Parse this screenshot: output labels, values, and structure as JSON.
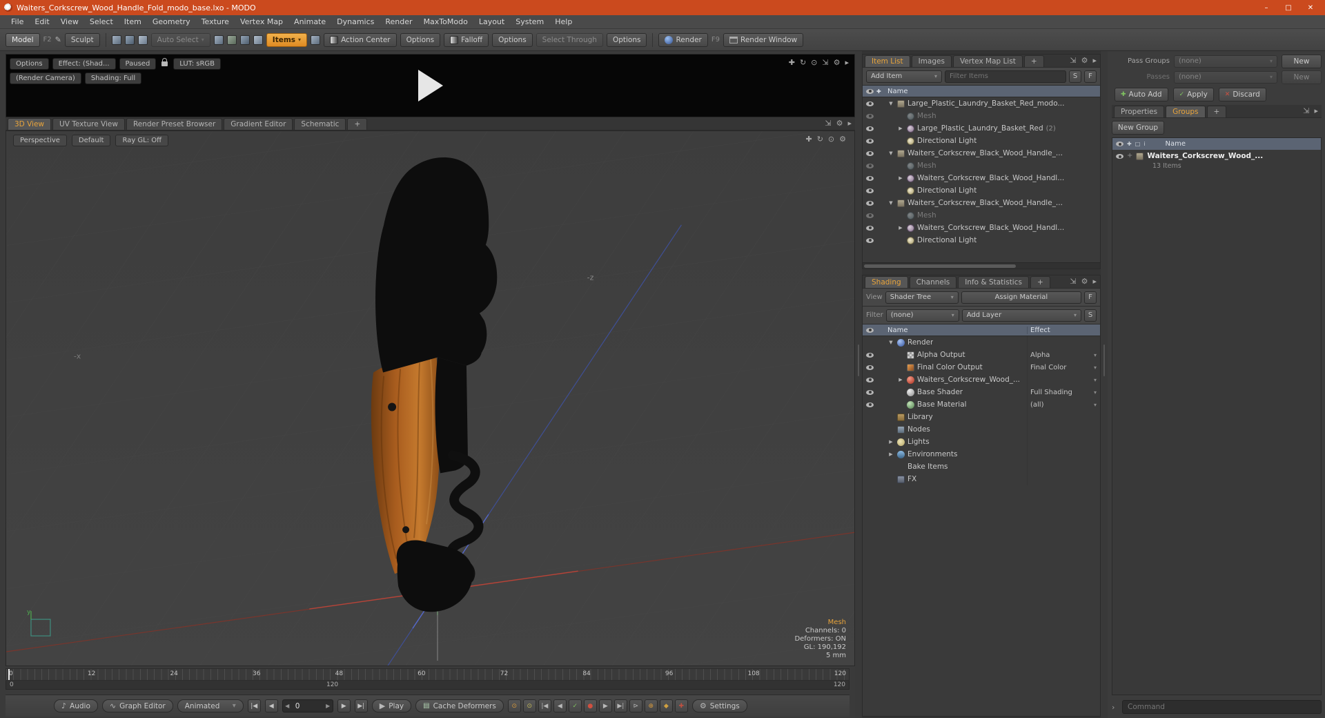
{
  "window": {
    "title": "Waiters_Corkscrew_Wood_Handle_Fold_modo_base.lxo - MODO",
    "minimize": "–",
    "maximize": "□",
    "close": "✕"
  },
  "menu": [
    "File",
    "Edit",
    "View",
    "Select",
    "Item",
    "Geometry",
    "Texture",
    "Vertex Map",
    "Animate",
    "Dynamics",
    "Render",
    "MaxToModo",
    "Layout",
    "System",
    "Help"
  ],
  "toolbar": {
    "model": "Model",
    "model_key": "F2",
    "sculpt": "Sculpt",
    "auto_select": "Auto Select",
    "items": "Items",
    "action_center": "Action Center",
    "options_a": "Options",
    "falloff": "Falloff",
    "options_b": "Options",
    "select_through": "Select Through",
    "options_c": "Options",
    "render": "Render",
    "render_key": "F9",
    "render_window": "Render Window"
  },
  "preview": {
    "options": "Options",
    "effect": "Effect: (Shad...",
    "paused": "Paused",
    "lut": "LUT: sRGB",
    "camera": "(Render Camera)",
    "shading": "Shading: Full"
  },
  "viewport": {
    "tabs": [
      {
        "label": "3D View",
        "active": true
      },
      {
        "label": "UV Texture View"
      },
      {
        "label": "Render Preset Browser"
      },
      {
        "label": "Gradient Editor"
      },
      {
        "label": "Schematic"
      },
      {
        "label": "+"
      }
    ],
    "perspective": "Perspective",
    "default_btn": "Default",
    "raygl": "Ray GL: Off",
    "axis_neg_z": "-z",
    "axis_neg_x": "-x",
    "axis_y": "y",
    "info": [
      "Mesh",
      "Channels: 0",
      "Deformers: ON",
      "GL: 190,192",
      "5 mm"
    ]
  },
  "timeline": {
    "ticks": [
      "0",
      "12",
      "24",
      "36",
      "48",
      "60",
      "72",
      "84",
      "96",
      "108",
      "120"
    ],
    "range_start": "0",
    "range_mid": "120",
    "range_end": "120"
  },
  "transport": {
    "audio": "Audio",
    "graph_editor": "Graph Editor",
    "mode": "Animated",
    "frame": "0",
    "play": "Play",
    "cache": "Cache Deformers",
    "settings": "Settings",
    "extra_icons": [
      {
        "glyph": "⊙",
        "name": "actor-icon",
        "color": "#d89a3c"
      },
      {
        "glyph": "⊙",
        "name": "pose-icon",
        "color": "#c6bb5a"
      },
      {
        "glyph": "|◀",
        "name": "previous-key-icon",
        "color": "#b8b8b8"
      },
      {
        "glyph": "◀",
        "name": "step-back-key-icon",
        "color": "#b8b8b8"
      },
      {
        "glyph": "✓",
        "name": "commit-icon",
        "color": "#7fc060"
      },
      {
        "glyph": "●",
        "name": "record-icon",
        "color": "#d05040"
      },
      {
        "glyph": "▶",
        "name": "step-forward-key-icon",
        "color": "#b8b8b8"
      },
      {
        "glyph": "▶|",
        "name": "next-key-icon",
        "color": "#b8b8b8"
      },
      {
        "glyph": "⊳",
        "name": "playback-options-icon",
        "color": "#b8b8b8"
      },
      {
        "glyph": "⊕",
        "name": "auto-key-icon",
        "color": "#d89a3c"
      },
      {
        "glyph": "◆",
        "name": "set-key-icon",
        "color": "#d0a040"
      },
      {
        "glyph": "✚",
        "name": "add-channel-key-icon",
        "color": "#c05040"
      }
    ]
  },
  "item_list": {
    "tabs": [
      {
        "label": "Item List",
        "active": true
      },
      {
        "label": "Images"
      },
      {
        "label": "Vertex Map List"
      },
      {
        "label": "+"
      }
    ],
    "add_item": "Add Item",
    "filter_placeholder": "Filter Items",
    "s_button": "S",
    "f_button": "F",
    "name_header": "Name",
    "rows": [
      {
        "indent": 1,
        "arrow": "open",
        "icon": "group",
        "label": "Large_Plastic_Laundry_Basket_Red_modo..."
      },
      {
        "indent": 2,
        "arrow": "none",
        "icon": "mesh",
        "label": "Mesh",
        "dim": true
      },
      {
        "indent": 2,
        "arrow": "closed",
        "icon": "meshinst",
        "label": "Large_Plastic_Laundry_Basket_Red",
        "count": "(2)"
      },
      {
        "indent": 2,
        "arrow": "none",
        "icon": "dirlight",
        "label": "Directional Light"
      },
      {
        "indent": 1,
        "arrow": "open",
        "icon": "group",
        "label": "Waiters_Corkscrew_Black_Wood_Handle_..."
      },
      {
        "indent": 2,
        "arrow": "none",
        "icon": "mesh",
        "label": "Mesh",
        "dim": true
      },
      {
        "indent": 2,
        "arrow": "closed",
        "icon": "meshinst",
        "label": "Waiters_Corkscrew_Black_Wood_Handl..."
      },
      {
        "indent": 2,
        "arrow": "none",
        "icon": "dirlight",
        "label": "Directional Light"
      },
      {
        "indent": 1,
        "arrow": "open",
        "icon": "group",
        "label": "Waiters_Corkscrew_Black_Wood_Handle_..."
      },
      {
        "indent": 2,
        "arrow": "none",
        "icon": "mesh",
        "label": "Mesh",
        "dim": true
      },
      {
        "indent": 2,
        "arrow": "closed",
        "icon": "meshinst",
        "label": "Waiters_Corkscrew_Black_Wood_Handl..."
      },
      {
        "indent": 2,
        "arrow": "none",
        "icon": "dirlight",
        "label": "Directional Light"
      }
    ]
  },
  "shading": {
    "tabs": [
      {
        "label": "Shading",
        "active": true
      },
      {
        "label": "Channels"
      },
      {
        "label": "Info & Statistics"
      },
      {
        "label": "+"
      }
    ],
    "view_label": "View",
    "view_value": "Shader Tree",
    "assign_material": "Assign Material",
    "f_button": "F",
    "filter_label": "Filter",
    "filter_value": "(none)",
    "add_layer": "Add Layer",
    "s_button": "S",
    "name_header": "Name",
    "effect_header": "Effect",
    "rows": [
      {
        "indent": 1,
        "arrow": "open",
        "icon": "render",
        "label": "Render",
        "effect": "",
        "eye": false
      },
      {
        "indent": 2,
        "arrow": "none",
        "icon": "alphaout",
        "label": "Alpha Output",
        "effect": "Alpha",
        "dd": true
      },
      {
        "indent": 2,
        "arrow": "none",
        "icon": "finalout",
        "label": "Final Color Output",
        "effect": "Final Color",
        "dd": true
      },
      {
        "indent": 2,
        "arrow": "closed",
        "icon": "matgroup",
        "label": "Waiters_Corkscrew_Wood_...",
        "effect": "",
        "dd": true
      },
      {
        "indent": 2,
        "arrow": "none",
        "icon": "shader",
        "label": "Base Shader",
        "effect": "Full Shading",
        "dd": true
      },
      {
        "indent": 2,
        "arrow": "none",
        "icon": "basemat",
        "label": "Base Material",
        "effect": "(all)",
        "dd": true
      },
      {
        "indent": 1,
        "arrow": "none",
        "icon": "library",
        "label": "Library",
        "effect": "",
        "eye": false
      },
      {
        "indent": 1,
        "arrow": "none",
        "icon": "nodes",
        "label": "Nodes",
        "effect": "",
        "eye": false
      },
      {
        "indent": 1,
        "arrow": "closed",
        "icon": "light",
        "label": "Lights",
        "effect": "",
        "eye": false
      },
      {
        "indent": 1,
        "arrow": "closed",
        "icon": "env",
        "label": "Environments",
        "effect": "",
        "eye": false
      },
      {
        "indent": 1,
        "arrow": "none",
        "icon": "bake",
        "label": "Bake Items",
        "effect": "",
        "eye": false
      },
      {
        "indent": 1,
        "arrow": "none",
        "icon": "fx",
        "label": "FX",
        "effect": "",
        "eye": false
      }
    ]
  },
  "groups_panel": {
    "pass_groups_label": "Pass Groups",
    "pass_groups_value": "(none)",
    "pass_groups_new": "New",
    "passes_label": "Passes",
    "passes_value": "(none)",
    "passes_new": "New",
    "auto_add": "Auto Add",
    "apply": "Apply",
    "discard": "Discard",
    "tabs": [
      {
        "label": "Properties"
      },
      {
        "label": "Groups",
        "active": true
      },
      {
        "label": "+"
      }
    ],
    "new_group": "New Group",
    "name_header": "Name",
    "row": {
      "label": "Waiters_Corkscrew_Wood_...",
      "sub": "13 Items",
      "expand": "+"
    }
  },
  "command": {
    "expander": "›",
    "placeholder": "Command"
  },
  "icons": {
    "dropdown": "▾",
    "pan": "✚",
    "rotate": "↻",
    "zoom": "⊙",
    "maximize": "⇲",
    "gear": "⚙",
    "more": "▸",
    "pen": "✎",
    "audio": "♪",
    "graph": "∿",
    "cache": "▤",
    "check": "✓",
    "cross": "✕",
    "plus": "✚",
    "skip_start": "|◀",
    "step_back": "◀",
    "step_fwd": "▶",
    "skip_end": "▶|",
    "play": "▶",
    "info": "i"
  }
}
